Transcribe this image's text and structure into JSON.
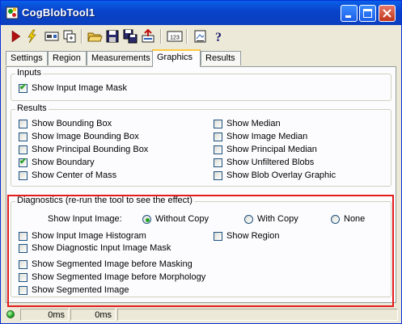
{
  "window": {
    "title": "CogBlobTool1"
  },
  "toolbar": {
    "buttons": [
      "run-icon",
      "electric-icon",
      "display-icon",
      "copy-icon",
      "open-folder-icon",
      "save-icon",
      "save-as-icon",
      "reset-icon",
      "numeric-display-icon",
      "image-properties-icon",
      "help-icon"
    ]
  },
  "tabs": [
    {
      "label": "Settings"
    },
    {
      "label": "Region"
    },
    {
      "label": "Measurements"
    },
    {
      "label": "Graphics",
      "active": true
    },
    {
      "label": "Results"
    }
  ],
  "inputs": {
    "legend": "Inputs",
    "show_input_image_mask": {
      "label": "Show Input Image Mask",
      "checked": true
    }
  },
  "results": {
    "legend": "Results",
    "left": [
      {
        "label": "Show Bounding Box",
        "checked": false
      },
      {
        "label": "Show Image Bounding Box",
        "checked": false
      },
      {
        "label": "Show Principal Bounding Box",
        "checked": false
      },
      {
        "label": "Show Boundary",
        "checked": true
      },
      {
        "label": "Show Center of Mass",
        "checked": false
      }
    ],
    "right": [
      {
        "label": "Show Median",
        "checked": false
      },
      {
        "label": "Show Image Median",
        "checked": false
      },
      {
        "label": "Show Principal Median",
        "checked": false
      },
      {
        "label": "Show Unfiltered Blobs",
        "checked": false
      },
      {
        "label": "Show Blob Overlay Graphic",
        "checked": false
      }
    ]
  },
  "diagnostics": {
    "legend": "Diagnostics (re-run the tool to see the effect)",
    "show_input_image_label": "Show Input Image:",
    "radio": [
      {
        "label": "Without Copy",
        "selected": true
      },
      {
        "label": "With Copy",
        "selected": false
      },
      {
        "label": "None",
        "selected": false
      }
    ],
    "checks": [
      {
        "label": "Show Input Image Histogram",
        "checked": false
      },
      {
        "label": "Show Diagnostic Input Image Mask",
        "checked": false
      },
      {
        "label": "Show Segmented Image before Masking",
        "checked": false
      },
      {
        "label": "Show Segmented Image before Morphology",
        "checked": false
      },
      {
        "label": "Show Segmented Image",
        "checked": false
      }
    ],
    "show_region": {
      "label": "Show Region",
      "checked": false
    }
  },
  "status": {
    "time1": "0ms",
    "time2": "0ms"
  },
  "colors": {
    "titlebar": "#0842c8",
    "highlight_frame": "#e41c1c",
    "check_mark": "#21a121"
  }
}
